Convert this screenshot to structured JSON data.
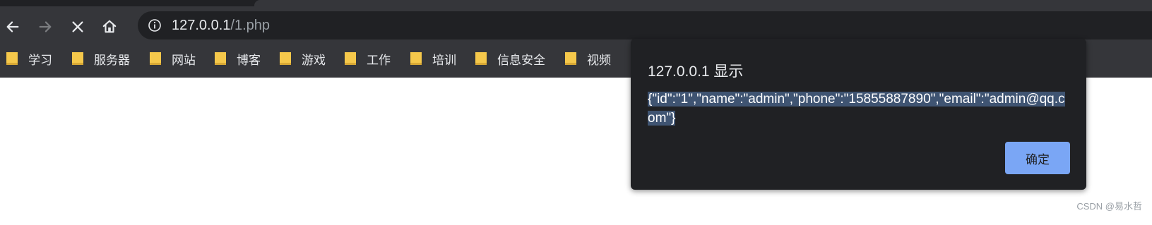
{
  "address_bar": {
    "host": "127.0.0.1",
    "path": "/1.php"
  },
  "bookmarks": [
    {
      "label": "学习"
    },
    {
      "label": "服务器"
    },
    {
      "label": "网站"
    },
    {
      "label": "博客"
    },
    {
      "label": "游戏"
    },
    {
      "label": "工作"
    },
    {
      "label": "培训"
    },
    {
      "label": "信息安全"
    },
    {
      "label": "视频"
    }
  ],
  "dialog": {
    "title": "127.0.0.1 显示",
    "message": "{\"id\":\"1\",\"name\":\"admin\",\"phone\":\"15855887890\",\"email\":\"admin@qq.com\"}",
    "ok_label": "确定"
  },
  "watermark": "CSDN @易水哲",
  "colors": {
    "toolbar": "#35363a",
    "omnibox": "#202124",
    "folder": "#f5c84b",
    "ok_button": "#7aa6f5",
    "selection": "#3f5472"
  },
  "icons": [
    "back-arrow-icon",
    "forward-arrow-icon",
    "stop-loading-icon",
    "home-icon",
    "info-icon",
    "folder-icon"
  ]
}
